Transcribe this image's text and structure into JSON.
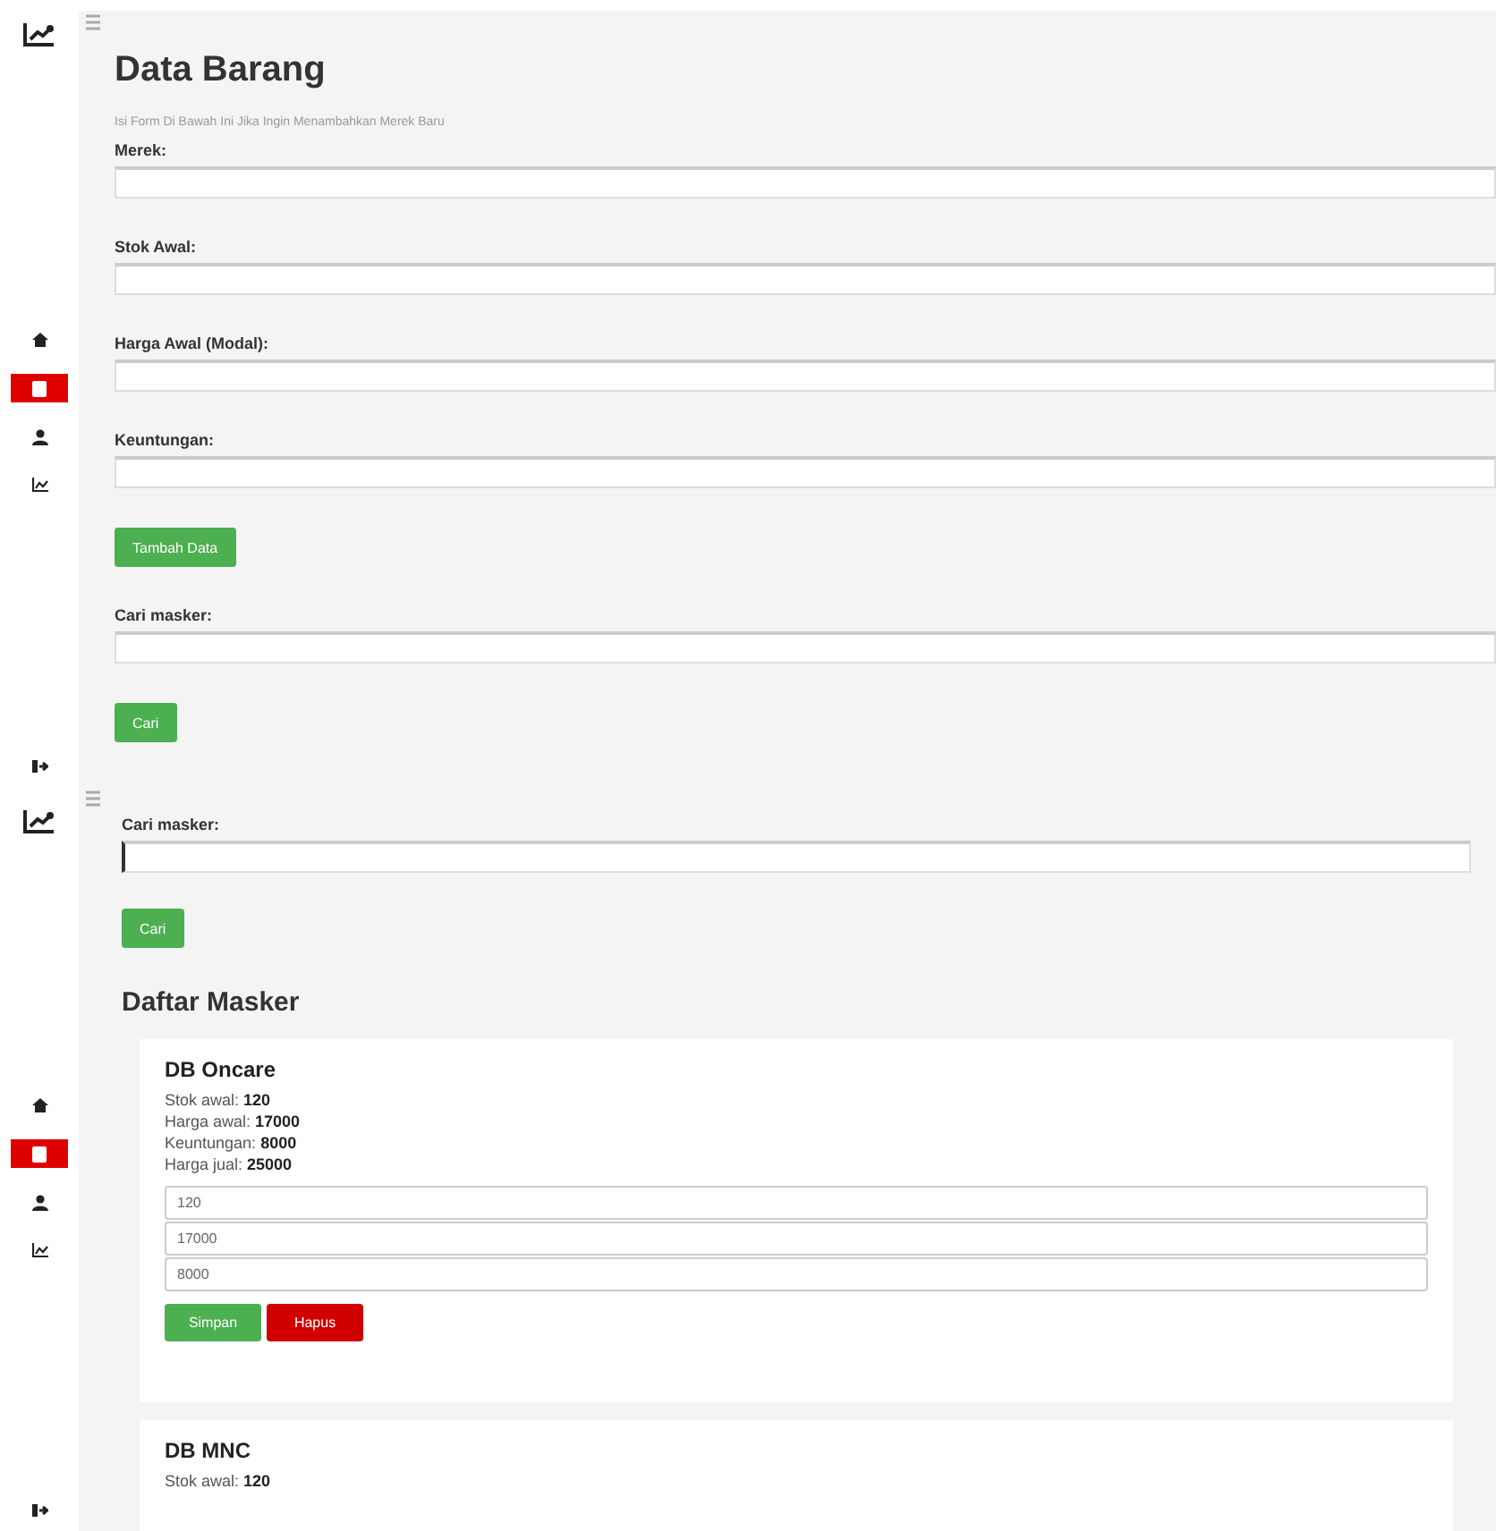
{
  "screens": [
    {
      "sidebar": {
        "items": [
          {
            "kind": "home",
            "selected": false
          },
          {
            "kind": "box",
            "selected": true
          },
          {
            "kind": "user",
            "selected": false
          },
          {
            "kind": "chart",
            "selected": false
          }
        ]
      },
      "sections": [
        {
          "kind": "title",
          "text": "Data Barang"
        },
        {
          "kind": "subtitle",
          "text": "Isi Form Di Bawah Ini Jika Ingin Menambahkan Merek Baru"
        },
        {
          "kind": "field",
          "label": "Merek:",
          "focused": false
        },
        {
          "kind": "field",
          "label": "Stok Awal:",
          "focused": false
        },
        {
          "kind": "field",
          "label": "Harga Awal (Modal):",
          "focused": false
        },
        {
          "kind": "field",
          "label": "Keuntungan:",
          "focused": false
        },
        {
          "kind": "button",
          "text": "Tambah Data"
        },
        {
          "kind": "field",
          "label": "Cari masker:",
          "focused": false
        },
        {
          "kind": "button",
          "text": "Cari"
        }
      ]
    },
    {
      "sidebar": {
        "items": [
          {
            "kind": "home",
            "selected": false
          },
          {
            "kind": "box",
            "selected": true
          },
          {
            "kind": "user",
            "selected": false
          },
          {
            "kind": "chart",
            "selected": false
          }
        ]
      },
      "sections": [
        {
          "kind": "field",
          "label": "Cari masker:",
          "focused": true
        },
        {
          "kind": "button",
          "text": "Cari"
        },
        {
          "kind": "heading",
          "text": "Daftar Masker"
        },
        {
          "kind": "card",
          "name": "DB Oncare",
          "lines": [
            "Stok awal: **120**",
            "Harga awal: **17000**",
            "Keuntungan: **8000**",
            "Harga jual: **25000**"
          ],
          "inputs": [
            "120",
            "17000",
            "8000"
          ],
          "save": "Simpan",
          "delete": "Hapus"
        },
        {
          "kind": "card",
          "name": "DB MNC",
          "lines": [
            "Stok awal: **120**"
          ]
        }
      ]
    }
  ]
}
